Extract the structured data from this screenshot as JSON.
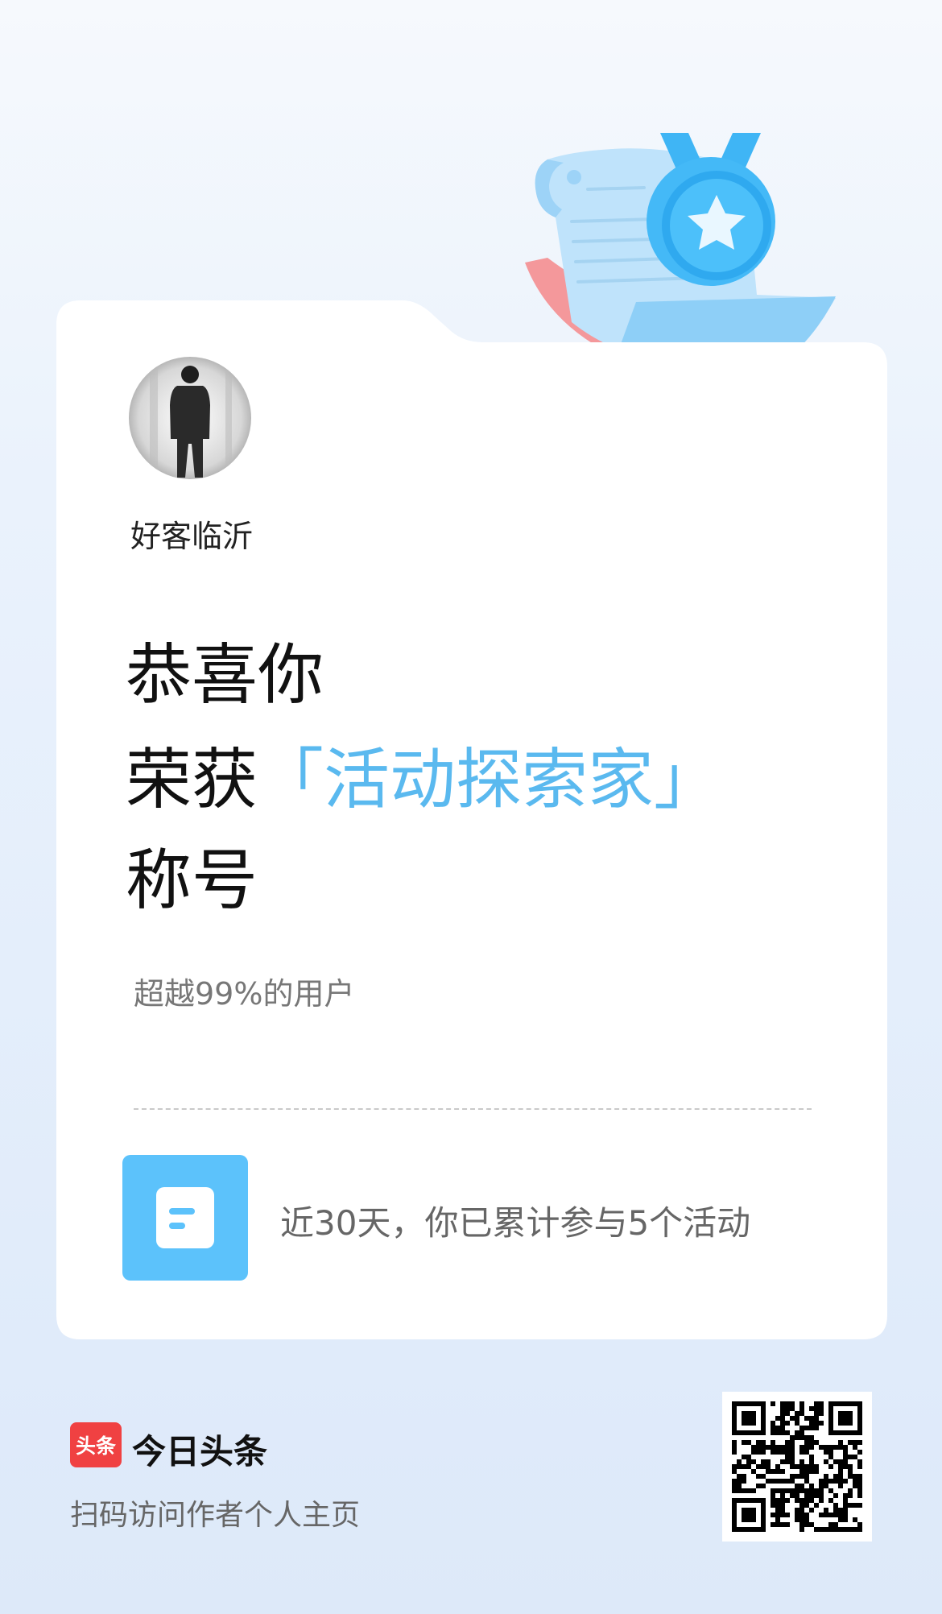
{
  "user": {
    "name": "好客临沂"
  },
  "headline": {
    "line1": "恭喜你",
    "line2_prefix": "荣获",
    "title_name": "「活动探索家」",
    "line3": "称号"
  },
  "subtext": "超越99%的用户",
  "stat": {
    "text": "近30天，你已累计参与5个活动"
  },
  "footer": {
    "logo_text": "头条",
    "app_name": "今日头条",
    "hint": "扫码访问作者个人主页"
  },
  "colors": {
    "accent": "#5ab9ef",
    "icon_bg": "#5cc2fb",
    "brand_red": "#f04142"
  },
  "icons": [
    "medal-scroll-illustration",
    "document-icon",
    "qr-code"
  ]
}
